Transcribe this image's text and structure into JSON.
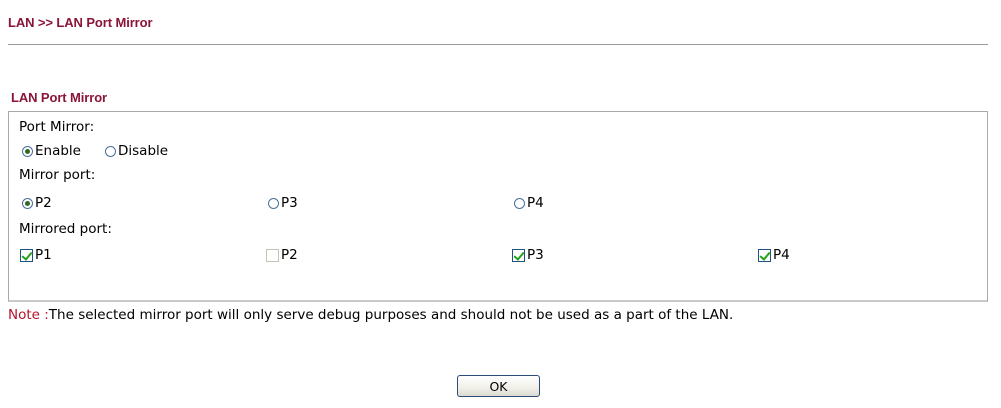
{
  "breadcrumb": "LAN >> LAN Port Mirror",
  "section": {
    "title": "LAN Port Mirror",
    "port_mirror": {
      "label": "Port Mirror:",
      "options": [
        {
          "label": "Enable",
          "checked": true
        },
        {
          "label": "Disable",
          "checked": false
        }
      ]
    },
    "mirror_port": {
      "label": "Mirror port:",
      "options": [
        {
          "label": "P2",
          "checked": true
        },
        {
          "label": "P3",
          "checked": false
        },
        {
          "label": "P4",
          "checked": false
        }
      ]
    },
    "mirrored_port": {
      "label": "Mirrored port:",
      "options": [
        {
          "label": "P1",
          "checked": true,
          "disabled": false
        },
        {
          "label": "P2",
          "checked": false,
          "disabled": true
        },
        {
          "label": "P3",
          "checked": true,
          "disabled": false
        },
        {
          "label": "P4",
          "checked": true,
          "disabled": false
        }
      ]
    }
  },
  "note": {
    "label": "Note :",
    "text": "The selected mirror port will only serve debug purposes and should not be used as a part of the LAN."
  },
  "ok_button": "OK",
  "colors": {
    "title": "#8a1538",
    "note_label": "#b3132b",
    "check_mark": "#23a21b",
    "radio_dot": "#2e6b21"
  }
}
